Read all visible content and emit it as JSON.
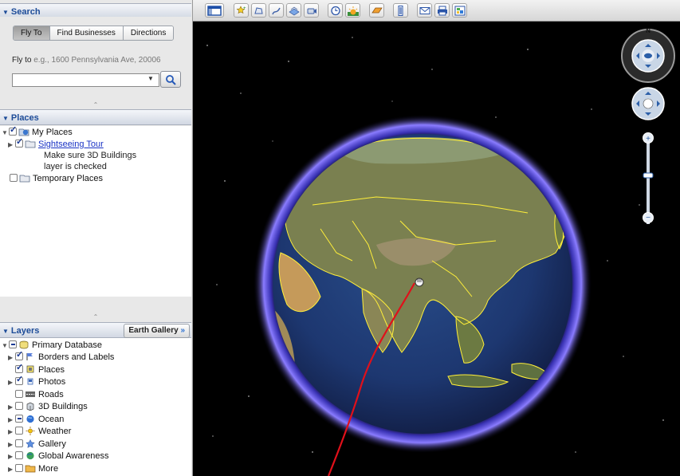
{
  "search": {
    "title": "Search",
    "tabs": [
      "Fly To",
      "Find Businesses",
      "Directions"
    ],
    "fly_to_label": "Fly to",
    "fly_to_hint": "e.g., 1600 Pennsylvania Ave, 20006",
    "fly_to_value": ""
  },
  "places": {
    "title": "Places",
    "items": [
      {
        "label": "My Places"
      },
      {
        "label": "Sightseeing Tour",
        "description_line1": "Make sure 3D Buildings",
        "description_line2": "layer is checked"
      },
      {
        "label": "Temporary Places"
      }
    ]
  },
  "layers": {
    "title": "Layers",
    "gallery_button": "Earth Gallery",
    "gallery_arrows": "»",
    "items": [
      {
        "label": "Primary Database"
      },
      {
        "label": "Borders and Labels"
      },
      {
        "label": "Places"
      },
      {
        "label": "Photos"
      },
      {
        "label": "Roads"
      },
      {
        "label": "3D Buildings"
      },
      {
        "label": "Ocean"
      },
      {
        "label": "Weather"
      },
      {
        "label": "Gallery"
      },
      {
        "label": "Global Awareness"
      },
      {
        "label": "More"
      }
    ]
  },
  "toolbar": {
    "icons": [
      "sidebar-toggle-icon",
      "placemark-icon",
      "polygon-icon",
      "path-icon",
      "image-overlay-icon",
      "record-tour-icon",
      "historical-imagery-icon",
      "sunlight-icon",
      "planets-icon",
      "ruler-icon",
      "email-icon",
      "print-icon",
      "view-in-maps-icon"
    ]
  },
  "navigation": {
    "compass_north": "N"
  },
  "colors": {
    "panel_title": "#1c4b98",
    "link": "#1a33c5",
    "border_lines": "#ffef3a",
    "tour_path": "#e0101a",
    "atmosphere": "#6a5cff"
  }
}
